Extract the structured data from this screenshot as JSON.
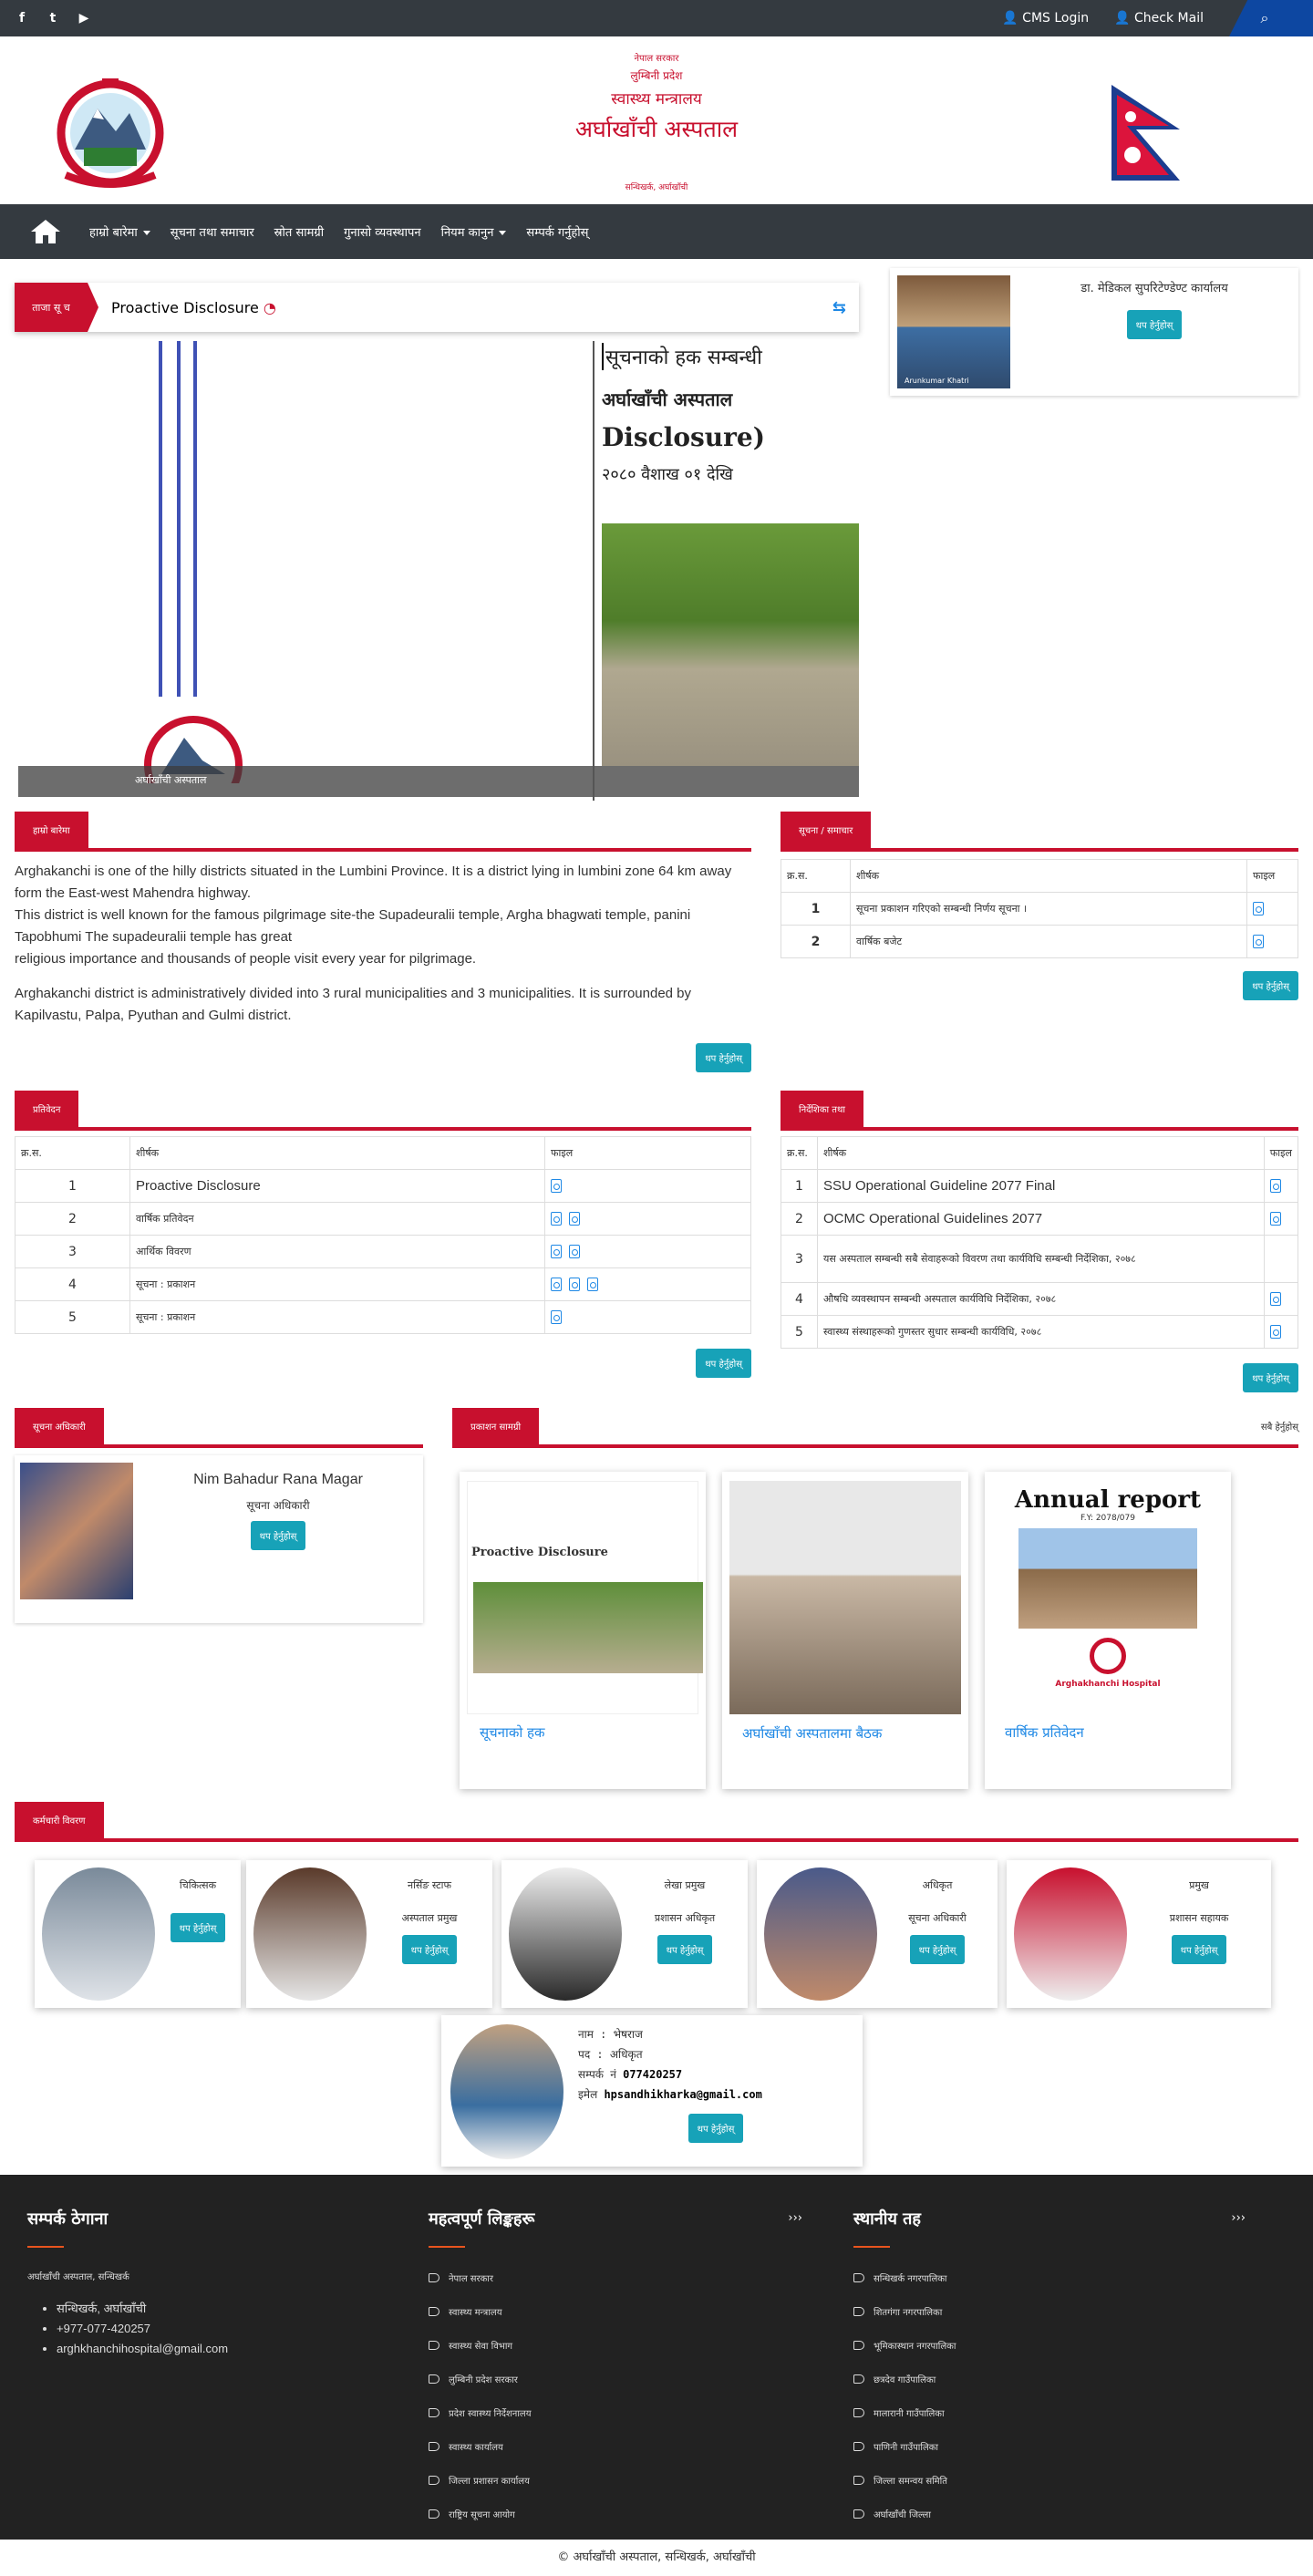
{
  "topbar": {
    "social": [
      "facebook-icon",
      "twitter-icon",
      "youtube-icon"
    ],
    "cms_login": "CMS Login",
    "check_mail": "Check Mail"
  },
  "header": {
    "line1": "नेपाल सरकार",
    "line2": "लुम्बिनी प्रदेश",
    "line3": "स्वास्थ्य मन्त्रालय",
    "title": "अर्घाखाँची अस्पताल",
    "address": "सन्धिखर्क, अर्घाखाँची"
  },
  "nav": {
    "items": [
      "हाम्रो बारेमा",
      "सूचना तथा समाचार",
      "स्रोत सामग्री",
      "गुनासो व्यवस्थापन",
      "नियम कानुन",
      "सम्पर्क गर्नुहोस्"
    ]
  },
  "ticker": {
    "tag": "ताजा सू च",
    "text": "Proactive Disclosure"
  },
  "slider": {
    "caption_left": "अर्घाखाँची अस्पताल",
    "doc_line1": "सूचनाको हक सम्बन्धी",
    "doc_line2": "अर्घाखाँची अस्पताल",
    "doc_line3": "Disclosure)",
    "doc_line4": "२०८० वैशाख ०१ देखि"
  },
  "chief": {
    "name": "डा. मेडिकल सुपरिटेण्डेण्ट कार्यालय",
    "btn": "थप हेर्नुहोस्",
    "photo_caption": "Arunkumar Khatri"
  },
  "about": {
    "title": "हाम्रो बारेमा",
    "p1": "Arghakanchi is one of the hilly districts situated in the Lumbini Province. It is a district lying in lumbini zone 64 km away form the East-west Mahendra highway.",
    "p2": "This district is well known for the famous pilgrimage site-the Supadeuralii temple, Argha bhagwati temple, panini Tapobhumi The supadeuralii temple has great",
    "p3": "religious importance and thousands of people visit every year for pilgrimage.",
    "p4": "Arghakanchi district is administratively divided into 3 rural municipalities and 3 municipalities. It is surrounded by Kapilvastu, Palpa, Pyuthan and Gulmi district.",
    "btn": "थप हेर्नुहोस्"
  },
  "notice": {
    "title": "सूचना / समाचार",
    "cols": [
      "क्र.स.",
      "शीर्षक",
      "फाइल"
    ],
    "rows": [
      {
        "n": "1",
        "t": "सूचना प्रकाशन गरिएको सम्बन्धी निर्णय सूचना ।",
        "f": 1
      },
      {
        "n": "2",
        "t": "वार्षिक बजेट",
        "f": 1
      }
    ],
    "btn": "थप हेर्नुहोस्"
  },
  "reports": {
    "title": "प्रतिवेदन",
    "cols": [
      "क्र.स.",
      "शीर्षक",
      "फाइल"
    ],
    "rows": [
      {
        "n": "1",
        "t": "Proactive Disclosure",
        "f": 1
      },
      {
        "n": "2",
        "t": "वार्षिक प्रतिवेदन",
        "f": 2
      },
      {
        "n": "3",
        "t": "आर्थिक विवरण",
        "f": 2
      },
      {
        "n": "4",
        "t": "सूचना : प्रकाशन",
        "f": 3
      },
      {
        "n": "5",
        "t": "सूचना : प्रकाशन",
        "f": 1
      }
    ],
    "btn": "थप हेर्नुहोस्"
  },
  "guides": {
    "title": "निर्देशिका तथा",
    "cols": [
      "क्र.स.",
      "शीर्षक",
      "फाइल"
    ],
    "rows": [
      {
        "n": "1",
        "t": "SSU Operational Guideline 2077 Final",
        "f": 1
      },
      {
        "n": "2",
        "t": "OCMC Operational Guidelines 2077",
        "f": 1
      },
      {
        "n": "3",
        "t": "यस अस्पताल सम्बन्धी सबै सेवाहरूको विवरण तथा कार्यविधि सम्बन्धी निर्देशिका, २०७८",
        "f": 0
      },
      {
        "n": "4",
        "t": "औषधि व्यवस्थापन सम्बन्धी अस्पताल कार्यविधि निर्देशिका, २०७८",
        "f": 1
      },
      {
        "n": "5",
        "t": "स्वास्थ्य संस्थाहरूको गुणस्तर सुधार सम्बन्धी कार्यविधि, २०७८",
        "f": 1
      }
    ],
    "btn": "थप हेर्नुहोस्"
  },
  "info_officer": {
    "title": "सूचना अधिकारी",
    "name": "Nim Bahadur Rana Magar",
    "role": "सूचना अधिकारी",
    "btn": "थप हेर्नुहोस्"
  },
  "publications": {
    "title": "प्रकाशन सामग्री",
    "view_all": "सबै हेर्नुहोस्",
    "items": [
      {
        "caption": "सूचनाको हक",
        "thumb_title": "Proactive Disclosure"
      },
      {
        "caption": "अर्घाखाँची अस्पतालमा बैठक",
        "thumb_title": ""
      },
      {
        "caption": "वार्षिक प्रतिवेदन",
        "thumb_title": "Annual report",
        "thumb_sub": "F.Y: 2078/079",
        "thumb_foot": "Arghakhanchi Hospital"
      }
    ]
  },
  "staff": {
    "title": "कर्मचारी विवरण",
    "members": [
      {
        "name": "चिकित्सक",
        "role": "",
        "btn": "थप हेर्नुहोस्"
      },
      {
        "name": "नर्सिङ स्टाफ",
        "role": "अस्पताल प्रमुख",
        "btn": "थप हेर्नुहोस्"
      },
      {
        "name": "लेखा प्रमुख",
        "role": "प्रशासन अधिकृत",
        "btn": "थप हेर्नुहोस्"
      },
      {
        "name": "अधिकृत",
        "role": "सूचना अधिकारी",
        "btn": "थप हेर्नुहोस्"
      },
      {
        "name": "प्रमुख",
        "role": "प्रशासन सहायक",
        "btn": "थप हेर्नुहोस्"
      }
    ],
    "featured": {
      "l1": "नाम : भेषराज",
      "l2": "पद : अधिकृत",
      "l3": "सम्पर्क नं ",
      "phone": "077420257",
      "l4": "इमेल ",
      "email": "hpsandhikharka@gmail.com",
      "btn": "थप हेर्नुहोस्"
    }
  },
  "footer": {
    "contact": {
      "title": "सम्पर्क ठेगाना",
      "sub": "अर्घाखाँची अस्पताल, सन्धिखर्क",
      "addr": "सन्धिखर्क, अर्घाखाँची",
      "phone": "+977-077-420257",
      "email": "arghkhanchihospital@gmail.com"
    },
    "col2": {
      "title": "महत्वपूर्ण लिङ्कहरू",
      "items": [
        "नेपाल सरकार",
        "स्वास्थ्य मन्त्रालय",
        "स्वास्थ्य सेवा विभाग",
        "लुम्बिनी प्रदेश सरकार",
        "प्रदेश स्वास्थ्य निर्देशनालय",
        "स्वास्थ्य कार्यालय",
        "जिल्ला प्रशासन कार्यालय",
        "राष्ट्रिय सूचना आयोग"
      ]
    },
    "col3": {
      "title": "स्थानीय तह",
      "items": [
        "सन्धिखर्क नगरपालिका",
        "शितगंगा नगरपालिका",
        "भूमिकास्थान नगरपालिका",
        "छत्रदेव गाउँपालिका",
        "मालारानी गाउँपालिका",
        "पाणिनी गाउँपालिका",
        "जिल्ला समन्वय समिति",
        "अर्घाखाँची जिल्ला"
      ]
    }
  },
  "copyright": "© अर्घाखाँची अस्पताल, सन्धिखर्क, अर्घाखाँची"
}
